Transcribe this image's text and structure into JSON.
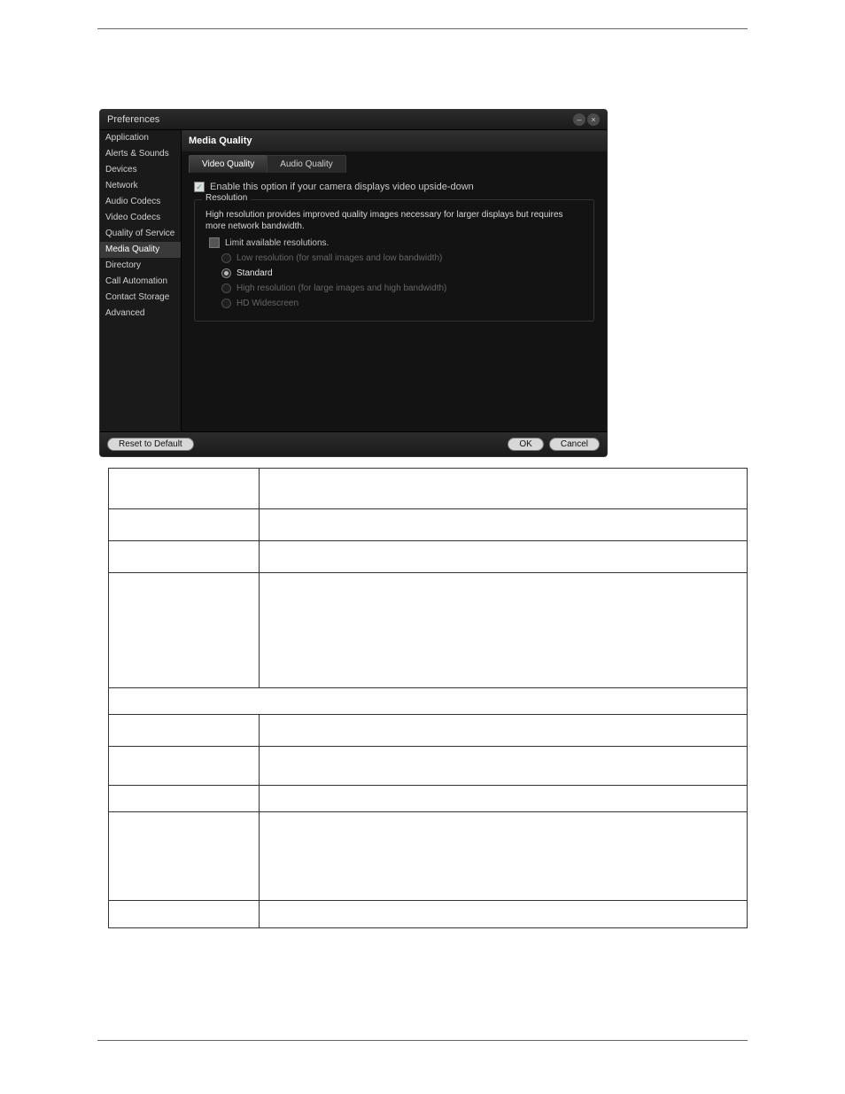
{
  "window": {
    "title": "Preferences",
    "buttons": {
      "minimize": "–",
      "close": "×"
    },
    "sidebar": {
      "items": [
        {
          "label": "Application"
        },
        {
          "label": "Alerts & Sounds"
        },
        {
          "label": "Devices"
        },
        {
          "label": "Network"
        },
        {
          "label": "Audio Codecs"
        },
        {
          "label": "Video Codecs"
        },
        {
          "label": "Quality of Service"
        },
        {
          "label": "Media Quality",
          "active": true
        },
        {
          "label": "Directory"
        },
        {
          "label": "Call Automation"
        },
        {
          "label": "Contact Storage"
        },
        {
          "label": "Advanced"
        }
      ]
    },
    "panel": {
      "title": "Media Quality",
      "tabs": [
        {
          "label": "Video Quality",
          "active": true
        },
        {
          "label": "Audio Quality"
        }
      ],
      "flip_option": {
        "checked": true,
        "label": "Enable this option if your camera displays video upside-down"
      },
      "resolution": {
        "legend": "Resolution",
        "desc": "High resolution provides improved quality images necessary for larger displays but requires more network bandwidth.",
        "limit": {
          "checked": false,
          "label": "Limit available resolutions."
        },
        "options": [
          {
            "label": "Low resolution (for small images and low bandwidth)",
            "selected": false,
            "enabled": false
          },
          {
            "label": "Standard",
            "selected": true,
            "enabled": true
          },
          {
            "label": "High resolution (for large images and high bandwidth)",
            "selected": false,
            "enabled": false
          },
          {
            "label": "HD Widescreen",
            "selected": false,
            "enabled": false
          }
        ]
      }
    },
    "footer": {
      "reset": "Reset to Default",
      "ok": "OK",
      "cancel": "Cancel"
    }
  }
}
